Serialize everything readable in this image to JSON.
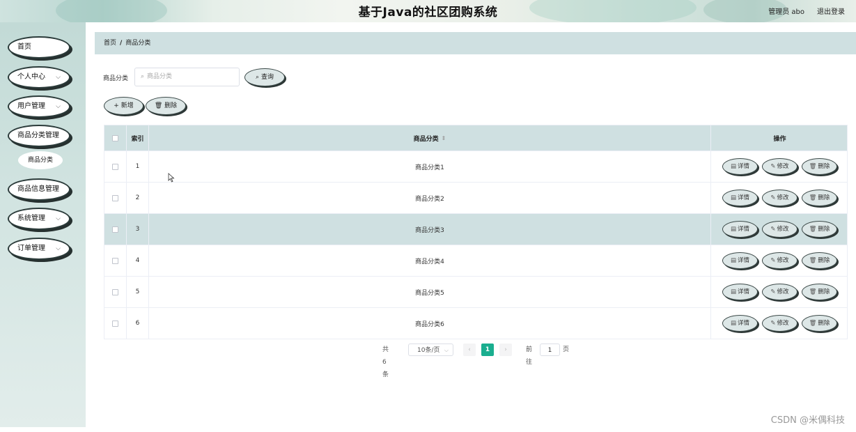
{
  "header": {
    "title": "基于Java的社区团购系统",
    "admin": "管理员 abo",
    "logout": "退出登录"
  },
  "sidebar": {
    "items": [
      {
        "label": "首页",
        "chevron": false
      },
      {
        "label": "个人中心",
        "chevron": true
      },
      {
        "label": "用户管理",
        "chevron": true
      },
      {
        "label": "商品分类管理",
        "chevron": false
      },
      {
        "label": "商品信息管理",
        "chevron": false
      },
      {
        "label": "系统管理",
        "chevron": true
      },
      {
        "label": "订单管理",
        "chevron": true
      }
    ],
    "sub_item": "商品分类"
  },
  "breadcrumb": {
    "home": "首页",
    "separator": "/",
    "current": "商品分类"
  },
  "search": {
    "label": "商品分类",
    "placeholder": "商品分类",
    "query_button": "查询"
  },
  "toolbar": {
    "add": "新增",
    "delete": "删除"
  },
  "table": {
    "headers": {
      "index": "索引",
      "category": "商品分类",
      "ops": "操作"
    },
    "rows": [
      {
        "index": "1",
        "category": "商品分类1"
      },
      {
        "index": "2",
        "category": "商品分类2"
      },
      {
        "index": "3",
        "category": "商品分类3"
      },
      {
        "index": "4",
        "category": "商品分类4"
      },
      {
        "index": "5",
        "category": "商品分类5"
      },
      {
        "index": "6",
        "category": "商品分类6"
      }
    ],
    "actions": {
      "detail": "详情",
      "edit": "修改",
      "delete": "删除"
    },
    "highlighted_row": 2
  },
  "pagination": {
    "total": "共 6 条",
    "page_size": "10条/页",
    "current": "1",
    "goto_label": "前往",
    "goto_value": "1",
    "page_suffix": "页"
  },
  "watermark": "CSDN @米偶科技",
  "colors": {
    "accent": "#1aae8f",
    "header_row": "#cfe0e1"
  }
}
